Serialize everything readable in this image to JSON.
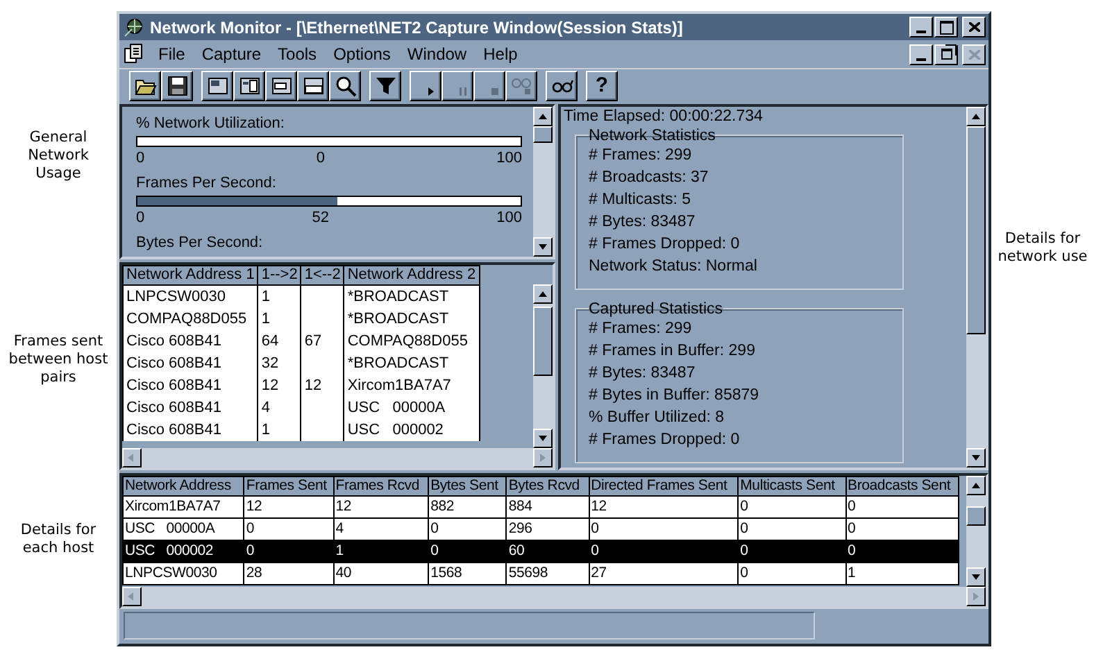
{
  "annotations": {
    "left": [
      "General Network Usage",
      "Frames sent between host pairs",
      "Details for each host"
    ],
    "right": [
      "Details for network use"
    ]
  },
  "window": {
    "title": "Network Monitor - [\\Ethernet\\NET2 Capture Window(Session Stats)]"
  },
  "menu": [
    {
      "label": "File"
    },
    {
      "label": "Capture"
    },
    {
      "label": "Tools"
    },
    {
      "label": "Options"
    },
    {
      "label": "Window"
    },
    {
      "label": "Help"
    }
  ],
  "toolbar": [
    [
      {
        "kind": "open",
        "disabled": false
      },
      {
        "kind": "save",
        "disabled": false
      }
    ],
    [
      {
        "kind": "pane-graph",
        "disabled": false
      },
      {
        "kind": "pane-session",
        "disabled": false
      },
      {
        "kind": "pane-station",
        "disabled": false
      },
      {
        "kind": "pane-total",
        "disabled": false
      },
      {
        "kind": "zoom",
        "disabled": false
      }
    ],
    [
      {
        "kind": "filter",
        "disabled": false
      }
    ],
    [
      {
        "kind": "start",
        "disabled": false
      },
      {
        "kind": "pause",
        "disabled": true
      },
      {
        "kind": "stop",
        "disabled": true
      },
      {
        "kind": "stop-view",
        "disabled": true
      }
    ],
    [
      {
        "kind": "view",
        "disabled": false
      }
    ],
    [
      {
        "kind": "help",
        "label": "?",
        "disabled": false
      }
    ]
  ],
  "gauges": [
    {
      "label": "% Network Utilization:",
      "level": 0,
      "min": "0",
      "reading": "0",
      "max": "100"
    },
    {
      "label": "Frames Per Second:",
      "level": 0.52,
      "min": "0",
      "reading": "52",
      "max": "100"
    },
    {
      "label": "Bytes Per Second:"
    }
  ],
  "pairs": {
    "columns": [
      "Network Address 1",
      "1-->2",
      "1<--2",
      "Network Address 2"
    ],
    "rows": [
      {
        "address_1": "LNPCSW0030",
        "forward": "1",
        "address_2": "*BROADCAST"
      },
      {
        "address_1": "COMPAQ88D055",
        "forward": "1",
        "address_2": "*BROADCAST"
      },
      {
        "address_1": "Cisco 608B41",
        "forward": "64",
        "backward": "67",
        "address_2": "COMPAQ88D055"
      },
      {
        "address_1": "Cisco 608B41",
        "forward": "32",
        "address_2": "*BROADCAST"
      },
      {
        "address_1": "Cisco 608B41",
        "forward": "12",
        "backward": "12",
        "address_2": "Xircom1BA7A7"
      },
      {
        "address_1": "Cisco 608B41",
        "forward": "4",
        "address_2": "USC   00000A"
      },
      {
        "address_1": "Cisco 608B41",
        "forward": "1",
        "address_2": "USC   000002"
      }
    ]
  },
  "session": {
    "time_elapsed": "Time Elapsed: 00:00:22.734",
    "groups": [
      {
        "title": "Network Statistics",
        "lines": [
          "# Frames: 299",
          "# Broadcasts: 37",
          "# Multicasts: 5",
          "# Bytes: 83487",
          "# Frames Dropped: 0",
          "Network Status: Normal"
        ]
      },
      {
        "title": "Captured Statistics",
        "lines": [
          "# Frames: 299",
          "# Frames in Buffer: 299",
          "# Bytes: 83487",
          "# Bytes in Buffer: 85879",
          "% Buffer Utilized: 8",
          "# Frames Dropped: 0"
        ]
      }
    ]
  },
  "hosts": {
    "columns": [
      "Network Address",
      "Frames Sent",
      "Frames Rcvd",
      "Bytes Sent",
      "Bytes Rcvd",
      "Directed Frames Sent",
      "Multicasts Sent",
      "Broadcasts Sent"
    ],
    "rows": [
      {
        "cells": [
          "Xircom1BA7A7",
          "12",
          "12",
          "882",
          "884",
          "12",
          "0",
          "0"
        ],
        "selected": false
      },
      {
        "cells": [
          "USC   00000A",
          "0",
          "4",
          "0",
          "296",
          "0",
          "0",
          "0"
        ],
        "selected": false
      },
      {
        "cells": [
          "USC   000002",
          "0",
          "1",
          "0",
          "60",
          "0",
          "0",
          "0"
        ],
        "selected": true
      },
      {
        "cells": [
          "LNPCSW0030",
          "28",
          "40",
          "1568",
          "55698",
          "27",
          "0",
          "1"
        ],
        "selected": false
      }
    ]
  }
}
